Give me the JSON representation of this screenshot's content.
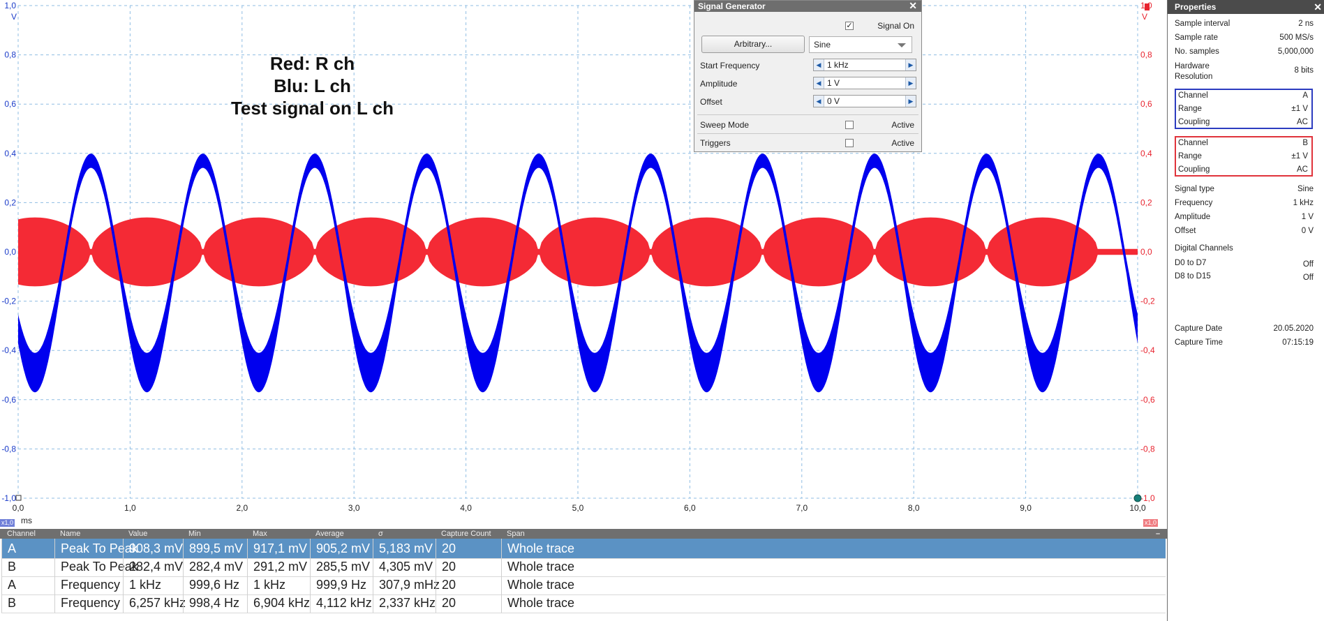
{
  "chart_data": {
    "type": "line",
    "x_axis": {
      "min": 0,
      "max": 10,
      "step": 1,
      "unit": "ms",
      "tick_labels": [
        "0,0",
        "1,0",
        "2,0",
        "3,0",
        "4,0",
        "5,0",
        "6,0",
        "7,0",
        "8,0",
        "9,0",
        "10,0"
      ]
    },
    "y_axis_left": {
      "min": -1,
      "max": 1,
      "unit": "V",
      "tick_labels": [
        "1,0",
        "0,8",
        "0,6",
        "0,4",
        "0,2",
        "0,0",
        "-0,2",
        "-0,4",
        "-0,6",
        "-0,8",
        "-1,0"
      ],
      "color": "#1a3bc9"
    },
    "y_axis_right": {
      "min": -1,
      "max": 1,
      "unit": "V",
      "tick_labels": [
        "1,0",
        "0,8",
        "0,6",
        "0,4",
        "0,2",
        "0,0",
        "-0,2",
        "-0,4",
        "-0,6",
        "-0,8",
        "-1,0"
      ],
      "color": "#e8242f"
    },
    "grid": true,
    "series": [
      {
        "name": "A",
        "color": "#0000ee",
        "frequency_khz": 1,
        "offset_v": -0.06,
        "amplitude_v": 0.43,
        "noise_band_v": 0.12,
        "phase_ms_peak": 0.65
      },
      {
        "name": "B",
        "color": "#f42a35",
        "burst_centers_ms": [
          0.15,
          1.15,
          2.15,
          3.15,
          4.15,
          5.15,
          6.15,
          7.15,
          8.15,
          9.15
        ],
        "burst_halfwidth_ms": 0.5,
        "burst_peak_v": 0.14,
        "baseline_noise_v": 0.012
      }
    ],
    "annotations": [
      "Red: R ch",
      "Blu: L ch",
      "Test signal on L ch"
    ]
  },
  "scale_tags": {
    "left": "x1,0",
    "right": "x1,0"
  },
  "signal_generator": {
    "title": "Signal Generator",
    "signal_on_label": "Signal On",
    "signal_on_checked": true,
    "arbitrary_label": "Arbitrary...",
    "waveform": "Sine",
    "start_frequency_label": "Start Frequency",
    "start_frequency": "1 kHz",
    "amplitude_label": "Amplitude",
    "amplitude": "1 V",
    "offset_label": "Offset",
    "offset": "0 V",
    "sweep_mode_label": "Sweep Mode",
    "sweep_active_label": "Active",
    "triggers_label": "Triggers",
    "triggers_active_label": "Active"
  },
  "properties": {
    "title": "Properties",
    "general": [
      {
        "k": "Sample interval",
        "v": "2 ns"
      },
      {
        "k": "Sample rate",
        "v": "500 MS/s"
      },
      {
        "k": "No. samples",
        "v": "5,000,000"
      }
    ],
    "hardware_resolution_label": [
      "Hardware",
      "Resolution"
    ],
    "hardware_resolution": "8 bits",
    "channel_a": [
      {
        "k": "Channel",
        "v": "A"
      },
      {
        "k": "Range",
        "v": "±1 V"
      },
      {
        "k": "Coupling",
        "v": "AC"
      }
    ],
    "channel_b": [
      {
        "k": "Channel",
        "v": "B"
      },
      {
        "k": "Range",
        "v": "±1 V"
      },
      {
        "k": "Coupling",
        "v": "AC"
      }
    ],
    "signal": [
      {
        "k": "Signal type",
        "v": "Sine"
      },
      {
        "k": "Frequency",
        "v": "1 kHz"
      },
      {
        "k": "Amplitude",
        "v": "1 V"
      },
      {
        "k": "Offset",
        "v": "0 V"
      }
    ],
    "digital_label": "Digital Channels",
    "digital": [
      {
        "k": "D0 to D7",
        "v": "Off"
      },
      {
        "k": "D8 to D15",
        "v": "Off"
      }
    ],
    "capture": [
      {
        "k": "Capture Date",
        "v": "20.05.2020"
      },
      {
        "k": "Capture Time",
        "v": "07:15:19"
      }
    ]
  },
  "measurements": {
    "columns": [
      "Channel",
      "Name",
      "Value",
      "Min",
      "Max",
      "Average",
      "σ",
      "Capture Count",
      "Span"
    ],
    "rows": [
      [
        "A",
        "Peak To Peak",
        "908,3 mV",
        "899,5 mV",
        "917,1 mV",
        "905,2 mV",
        "5,183 mV",
        "20",
        "Whole trace"
      ],
      [
        "B",
        "Peak To Peak",
        "282,4 mV",
        "282,4 mV",
        "291,2 mV",
        "285,5 mV",
        "4,305 mV",
        "20",
        "Whole trace"
      ],
      [
        "A",
        "Frequency",
        "1 kHz",
        "999,6 Hz",
        "1 kHz",
        "999,9 Hz",
        "307,9 mHz",
        "20",
        "Whole trace"
      ],
      [
        "B",
        "Frequency",
        "6,257 kHz",
        "998,4 Hz",
        "6,904 kHz",
        "4,112 kHz",
        "2,337 kHz",
        "20",
        "Whole trace"
      ]
    ],
    "selected_row": 0,
    "collapse_glyph": "–"
  }
}
